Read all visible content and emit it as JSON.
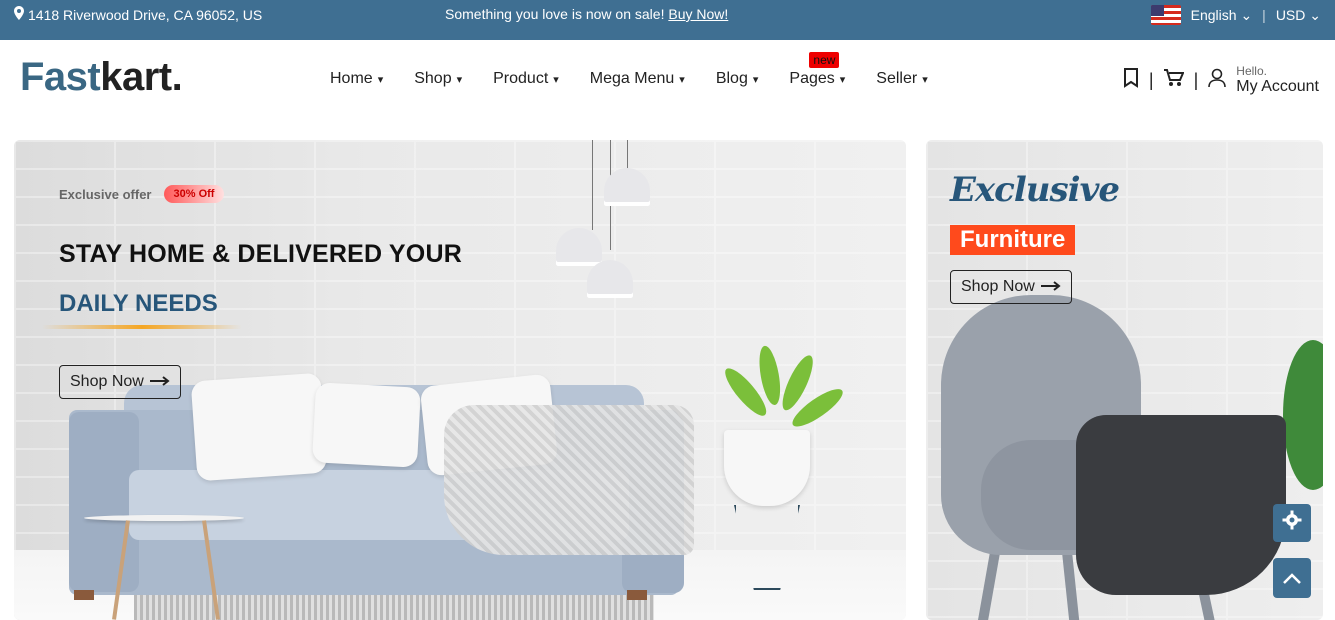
{
  "topbar": {
    "address": "1418 Riverwood Drive, CA 96052, US",
    "sale_text": "Something you love is now on sale!",
    "sale_link": "Buy Now!",
    "language": "English",
    "currency": "USD",
    "separator": "|"
  },
  "header": {
    "logo_part1": "Fast",
    "logo_part2": "kart.",
    "nav": [
      {
        "label": "Home"
      },
      {
        "label": "Shop"
      },
      {
        "label": "Product"
      },
      {
        "label": "Mega Menu"
      },
      {
        "label": "Blog"
      },
      {
        "label": "Pages",
        "badge": "new"
      },
      {
        "label": "Seller"
      }
    ],
    "account_hello": "Hello.",
    "account_label": "My Account",
    "separator": "|"
  },
  "hero": {
    "offer_label": "Exclusive offer",
    "offer_badge": "30% Off",
    "headline": "STAY HOME & DELIVERED YOUR",
    "subheadline": "DAILY NEEDS",
    "button_label": "Shop Now"
  },
  "side_banner": {
    "title": "Exclusive",
    "tag": "Furniture",
    "button_label": "Shop Now"
  },
  "colors": {
    "topbar_bg": "#3f6f92",
    "accent_blue": "#27567a",
    "badge_red": "#ff4a1c"
  }
}
